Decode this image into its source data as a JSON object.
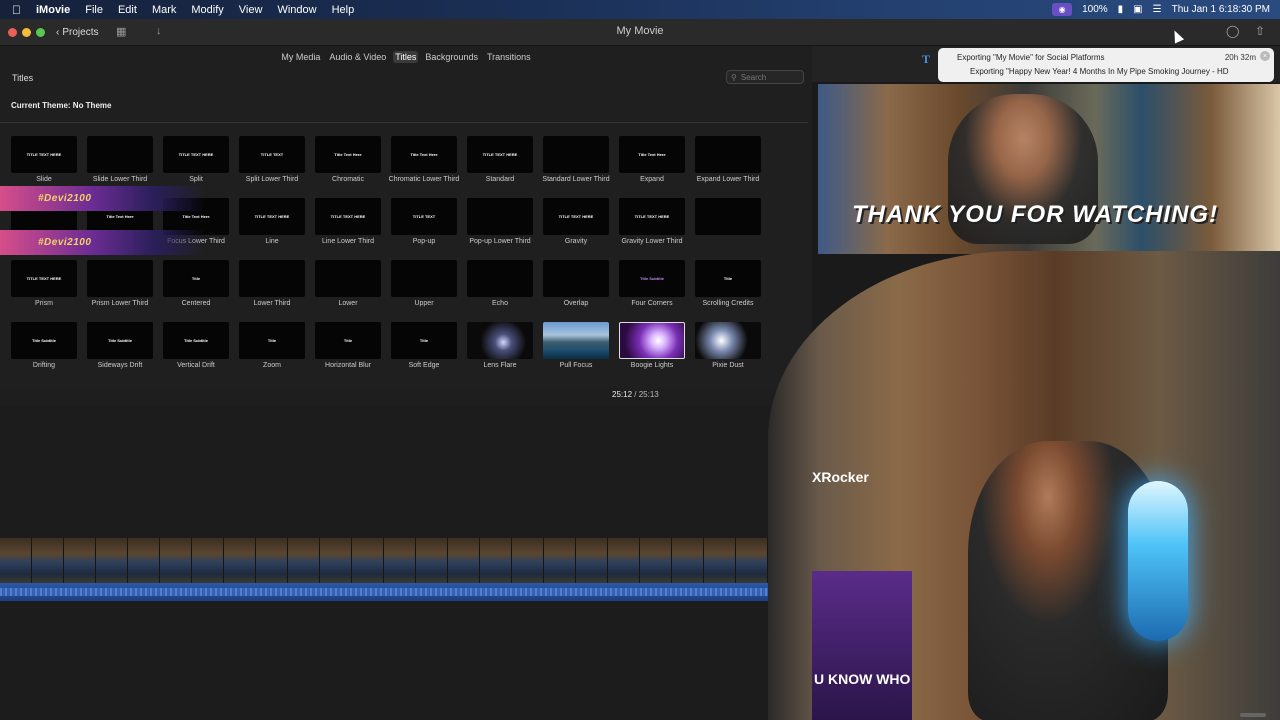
{
  "menubar": {
    "app_name": "iMovie",
    "items": [
      "File",
      "Edit",
      "Mark",
      "Modify",
      "View",
      "Window",
      "Help"
    ],
    "battery": "100%",
    "clock": "Thu Jan 1  6:18:30 PM"
  },
  "window": {
    "title": "My Movie",
    "projects_label": "Projects"
  },
  "browser": {
    "tabs": [
      "My Media",
      "Audio & Video",
      "Titles",
      "Backgrounds",
      "Transitions"
    ],
    "active_tab": "Titles",
    "section_title": "Titles",
    "search_placeholder": "Search",
    "theme_label": "Current Theme: No Theme",
    "titles": [
      {
        "label": "Slide",
        "thumb": "TITLE TEXT HERE"
      },
      {
        "label": "Slide Lower Third",
        "thumb": ""
      },
      {
        "label": "Split",
        "thumb": "TITLE TEXT HERE"
      },
      {
        "label": "Split Lower Third",
        "thumb": "TITLE TEXT"
      },
      {
        "label": "Chromatic",
        "thumb": "Title Text Here"
      },
      {
        "label": "Chromatic Lower Third",
        "thumb": "Title Text Here"
      },
      {
        "label": "Standard",
        "thumb": "TITLE TEXT HERE"
      },
      {
        "label": "Standard Lower Third",
        "thumb": ""
      },
      {
        "label": "Expand",
        "thumb": "Title Text Here"
      },
      {
        "label": "Expand Lower Third",
        "thumb": ""
      },
      {
        "label": "",
        "thumb": ""
      },
      {
        "label": "Focus",
        "thumb": "Title Text Here"
      },
      {
        "label": "Focus Lower Third",
        "thumb": "Title Text Here"
      },
      {
        "label": "Line",
        "thumb": "TITLE TEXT HERE"
      },
      {
        "label": "Line Lower Third",
        "thumb": "TITLE TEXT HERE"
      },
      {
        "label": "Pop-up",
        "thumb": "TITLE TEXT"
      },
      {
        "label": "Pop-up Lower Third",
        "thumb": ""
      },
      {
        "label": "Gravity",
        "thumb": "TITLE TEXT HERE"
      },
      {
        "label": "Gravity Lower Third",
        "thumb": "TITLE TEXT HERE"
      },
      {
        "label": "",
        "thumb": ""
      },
      {
        "label": "Prism",
        "thumb": "TITLE TEXT HERE"
      },
      {
        "label": "Prism Lower Third",
        "thumb": ""
      },
      {
        "label": "Centered",
        "thumb": "Title"
      },
      {
        "label": "Lower Third",
        "thumb": ""
      },
      {
        "label": "Lower",
        "thumb": ""
      },
      {
        "label": "Upper",
        "thumb": ""
      },
      {
        "label": "Echo",
        "thumb": ""
      },
      {
        "label": "Overlap",
        "thumb": ""
      },
      {
        "label": "Four Corners",
        "thumb": "Title Subtitle"
      },
      {
        "label": "Scrolling Credits",
        "thumb": "Title"
      },
      {
        "label": "Drifting",
        "thumb": "Title Subtitle"
      },
      {
        "label": "Sideways Drift",
        "thumb": "Title Subtitle"
      },
      {
        "label": "Vertical Drift",
        "thumb": "Title Subtitle"
      },
      {
        "label": "Zoom",
        "thumb": "Title"
      },
      {
        "label": "Horizontal Blur",
        "thumb": "Title"
      },
      {
        "label": "Soft Edge",
        "thumb": "Title"
      },
      {
        "label": "Lens Flare",
        "thumb": ""
      },
      {
        "label": "Pull Focus",
        "thumb": ""
      },
      {
        "label": "Boogie Lights",
        "thumb": ""
      },
      {
        "label": "Pixie Dust",
        "thumb": ""
      }
    ],
    "overlay_handles": [
      "#Devi2100",
      "#Devi2100"
    ]
  },
  "timecode": {
    "current": "25:12",
    "separator": "/",
    "total": "25:13"
  },
  "export": {
    "line1": "Exporting \"My Movie\" for Social Platforms",
    "time_left": "20h 32m",
    "line2": "Exporting \"Happy New Year! 4 Months In My Pipe Smoking Journey - HD"
  },
  "viewer": {
    "overlay_text": "THANK YOU FOR WATCHING!",
    "chair_brand": "XRocker",
    "shelf_text": "U KNOW WHO"
  },
  "colors": {
    "accent": "#4a90e2",
    "audio": "#2b58a8"
  }
}
